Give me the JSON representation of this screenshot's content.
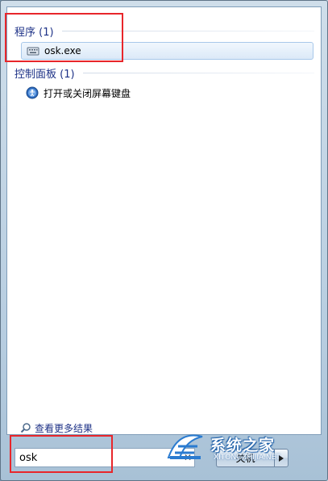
{
  "groups": [
    {
      "header": "程序 (1)",
      "items": [
        {
          "label": "osk.exe",
          "icon": "keyboard-icon",
          "selected": true
        }
      ]
    },
    {
      "header": "控制面板 (1)",
      "items": [
        {
          "label": "打开或关闭屏幕键盘",
          "icon": "ease-of-access-icon",
          "selected": false
        }
      ]
    }
  ],
  "see_more": {
    "label": "查看更多结果",
    "icon": "search-icon"
  },
  "search": {
    "value": "osk",
    "clear_icon": "close-icon"
  },
  "shutdown": {
    "label": "关机",
    "arrow_icon": "triangle-right-icon"
  },
  "watermark": {
    "main": "系统之家",
    "sub": "XITONGZHIJIA.NET"
  },
  "annotation_color": "#e8262b"
}
